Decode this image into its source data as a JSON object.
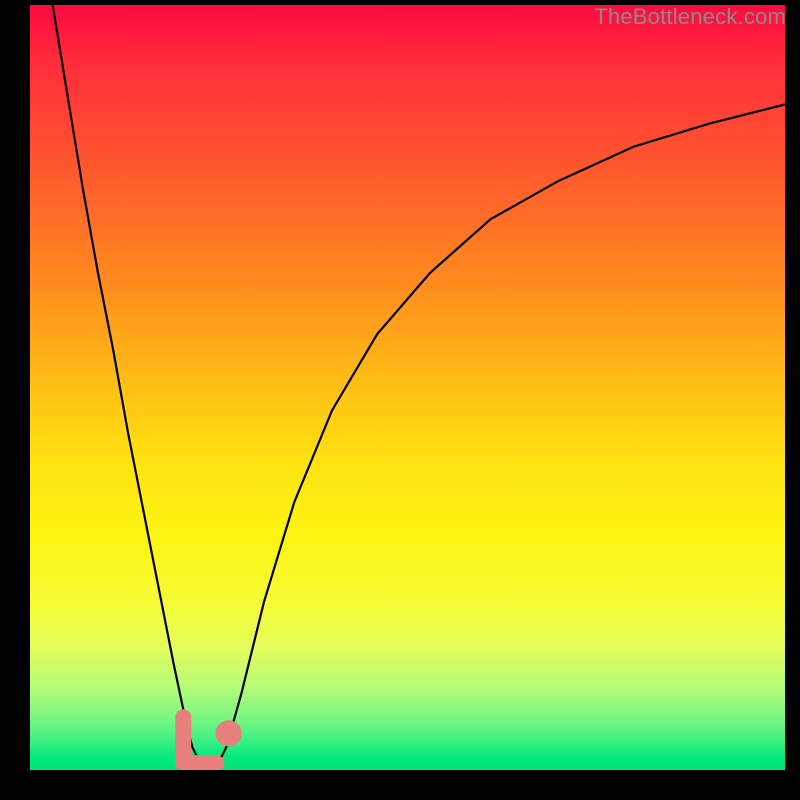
{
  "watermark": "TheBottleneck.com",
  "chart_data": {
    "type": "line",
    "title": "",
    "xlabel": "",
    "ylabel": "",
    "xlim": [
      0,
      100
    ],
    "ylim": [
      0,
      100
    ],
    "grid": false,
    "series": [
      {
        "name": "left-branch",
        "x": [
          3,
          5,
          7,
          9,
          11,
          13,
          15,
          17,
          19,
          20.5,
          21.5,
          22.5
        ],
        "values": [
          100,
          88,
          76,
          65,
          55,
          44,
          34,
          24,
          14,
          7,
          3,
          1
        ]
      },
      {
        "name": "right-branch",
        "x": [
          25,
          26,
          28,
          31,
          35,
          40,
          46,
          53,
          61,
          70,
          80,
          90,
          100
        ],
        "values": [
          1,
          3,
          10,
          22,
          35,
          47,
          57,
          65,
          72,
          77,
          81.5,
          84.5,
          87
        ]
      }
    ],
    "markers": [
      {
        "name": "pink-blob-L",
        "shape": "L-stroke",
        "cx": 22.5,
        "cy": 2.5,
        "size": 4,
        "color": "#e77f7d"
      },
      {
        "name": "pink-blob-dot",
        "shape": "dot",
        "cx": 26.3,
        "cy": 4.8,
        "size": 1.2,
        "color": "#e77f7d"
      }
    ],
    "background_gradient": {
      "top": "#ff0a40",
      "mid": "#ffe310",
      "bottom": "#00e37a"
    }
  },
  "colors": {
    "frame": "#000000",
    "curve": "#000000",
    "marker": "#e77f7d",
    "watermark": "#8b8b8b"
  }
}
